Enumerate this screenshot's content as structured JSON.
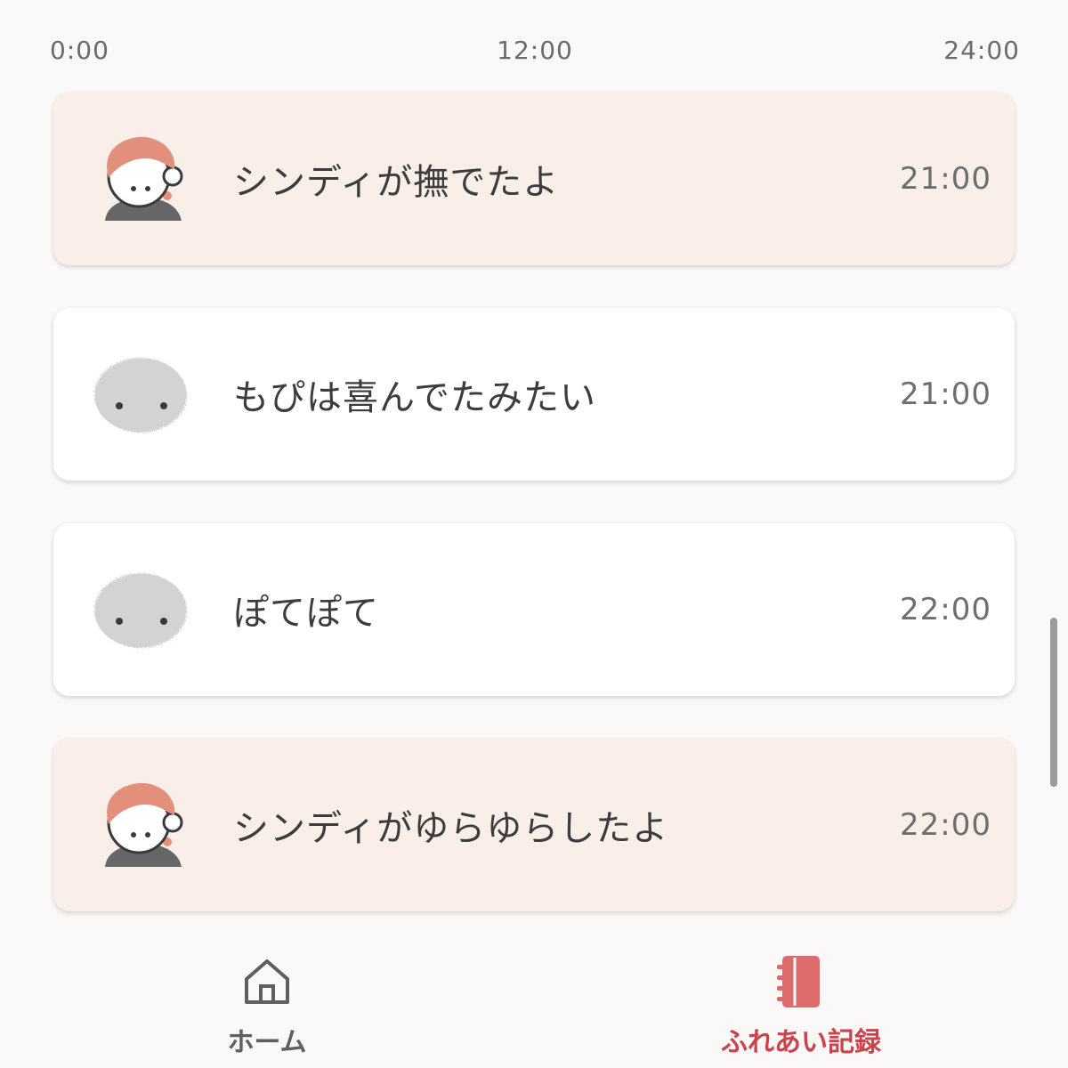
{
  "timeline": {
    "start_label": "0:00",
    "mid_label": "12:00",
    "end_label": "24:00"
  },
  "records": [
    {
      "type": "human",
      "text": "シンディが撫でたよ",
      "time": "21:00"
    },
    {
      "type": "pet",
      "text": "もぴは喜んでたみたい",
      "time": "21:00"
    },
    {
      "type": "pet",
      "text": "ぽてぽて",
      "time": "22:00"
    },
    {
      "type": "human",
      "text": "シンディがゆらゆらしたよ",
      "time": "22:00"
    }
  ],
  "bottom_nav": {
    "home_label": "ホーム",
    "home_icon": "home-icon",
    "records_label": "ふれあい記録",
    "records_icon": "notebook-icon",
    "active": "records"
  },
  "colors": {
    "background": "#faf9f8",
    "human_card": "#f9efe8",
    "pet_card": "#ffffff",
    "accent": "#c8454e",
    "hair": "#e2907c",
    "pet_fur": "#d3d3d6"
  }
}
